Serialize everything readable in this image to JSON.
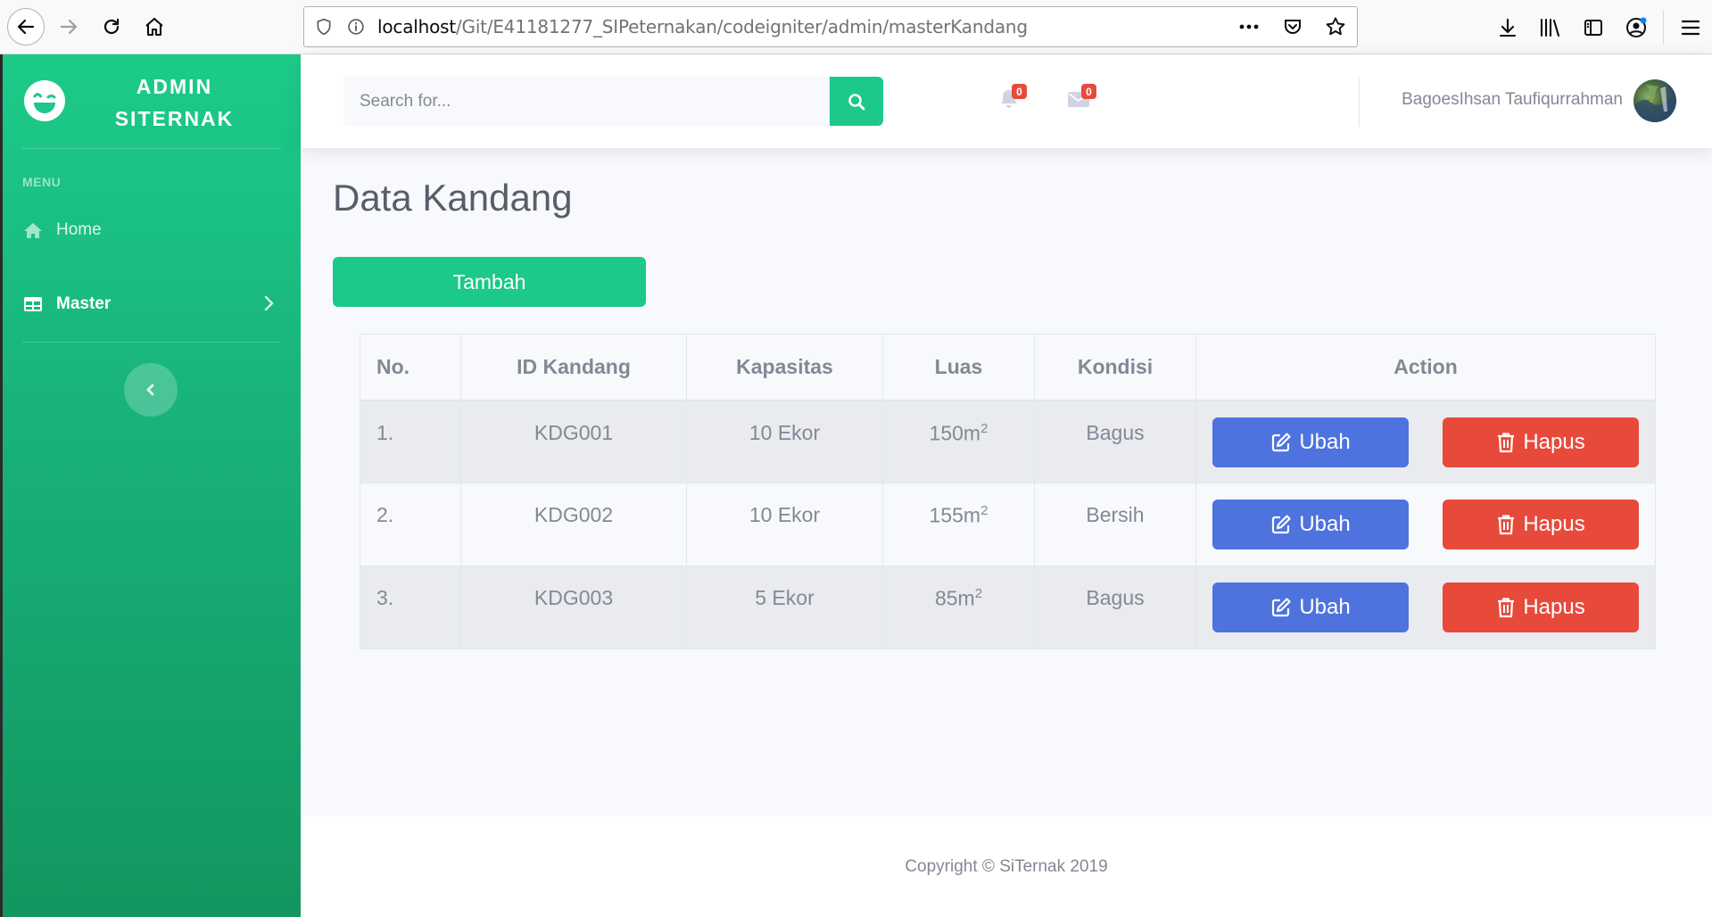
{
  "browser": {
    "url_host": "localhost",
    "url_path": "/Git/E41181277_SIPeternakan/codeigniter/admin/masterKandang"
  },
  "sidebar": {
    "brand_line1": "ADMIN",
    "brand_line2": "SITERNAK",
    "heading": "MENU",
    "items": [
      {
        "label": "Home",
        "icon": "home-icon"
      },
      {
        "label": "Master",
        "icon": "table-icon"
      }
    ]
  },
  "topbar": {
    "search_placeholder": "Search for...",
    "alerts_count": "0",
    "messages_count": "0",
    "user_name": "BagoesIhsan Taufiqurrahman"
  },
  "page": {
    "title": "Data Kandang",
    "add_button": "Tambah"
  },
  "table": {
    "headers": [
      "No.",
      "ID Kandang",
      "Kapasitas",
      "Luas",
      "Kondisi",
      "Action"
    ],
    "rows": [
      {
        "no": "1.",
        "id": "KDG001",
        "kapasitas": "10 Ekor",
        "luas": "150m",
        "luas_sup": "2",
        "kondisi": "Bagus"
      },
      {
        "no": "2.",
        "id": "KDG002",
        "kapasitas": "10 Ekor",
        "luas": "155m",
        "luas_sup": "2",
        "kondisi": "Bersih"
      },
      {
        "no": "3.",
        "id": "KDG003",
        "kapasitas": "5 Ekor",
        "luas": "85m",
        "luas_sup": "2",
        "kondisi": "Bagus"
      }
    ],
    "edit_label": "Ubah",
    "delete_label": "Hapus"
  },
  "footer": {
    "copyright": "Copyright © SiTernak 2019"
  },
  "colors": {
    "primary_green": "#1cc88a",
    "edit_blue": "#4e73df",
    "delete_red": "#e74a3b"
  }
}
